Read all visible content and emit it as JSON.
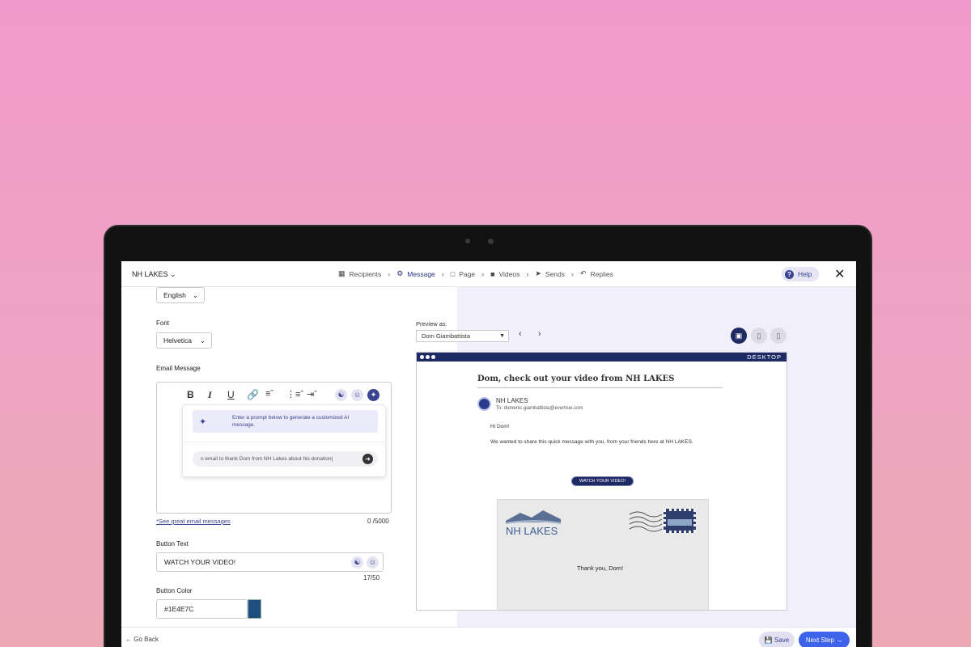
{
  "nav": {
    "brand": "NH LAKES",
    "steps": [
      {
        "label": "Recipients",
        "icon": "id-card-icon"
      },
      {
        "label": "Message",
        "icon": "gear-icon"
      },
      {
        "label": "Page",
        "icon": "window-icon"
      },
      {
        "label": "Videos",
        "icon": "video-camera-icon"
      },
      {
        "label": "Sends",
        "icon": "paper-plane-icon"
      },
      {
        "label": "Replies",
        "icon": "reply-icon"
      }
    ],
    "active_step": "Message",
    "help_label": "Help"
  },
  "form": {
    "language_value": "English",
    "font_label": "Font",
    "font_value": "Helvetica",
    "email_message_label": "Email Message",
    "ai_hint": "Enter a prompt below to generate a customized AI message.",
    "ai_prompt_value": "n email to thank Dom from NH Lakes about his donation|",
    "see_link": "*See great email messages",
    "message_count": "0 /5000",
    "button_text_label": "Button Text",
    "button_text_value": "WATCH YOUR VIDEO!",
    "button_text_count": "17/50",
    "button_color_label": "Button Color",
    "button_color_value": "#1E4E7C"
  },
  "preview": {
    "preview_as_label": "Preview as:",
    "preview_as_value": "Dom Giambattista",
    "device_label": "DESKTOP",
    "subject": "Dom, check out your video from NH LAKES",
    "sender": "NH LAKES",
    "to": "To: domenic.giambattista@evertrue.com",
    "greeting": "Hi Dom!",
    "body": "We wanted to share this quick message with you, from your friends here at NH LAKES.",
    "cta_button": "WATCH YOUR VIDEO!",
    "card_logo": "NH LAKES",
    "card_thanks": "Thank you, Dom!"
  },
  "footer": {
    "go_back": "Go Back",
    "save": "Save",
    "next_step": "Next Step"
  },
  "colors": {
    "background_top": "#f09acb",
    "background_bottom": "#eca9b4",
    "brand_navy": "#1e2a63",
    "accent_blue": "#3d63ea",
    "preview_panel": "#f2effc",
    "button_swatch": "#1E4E7C"
  }
}
